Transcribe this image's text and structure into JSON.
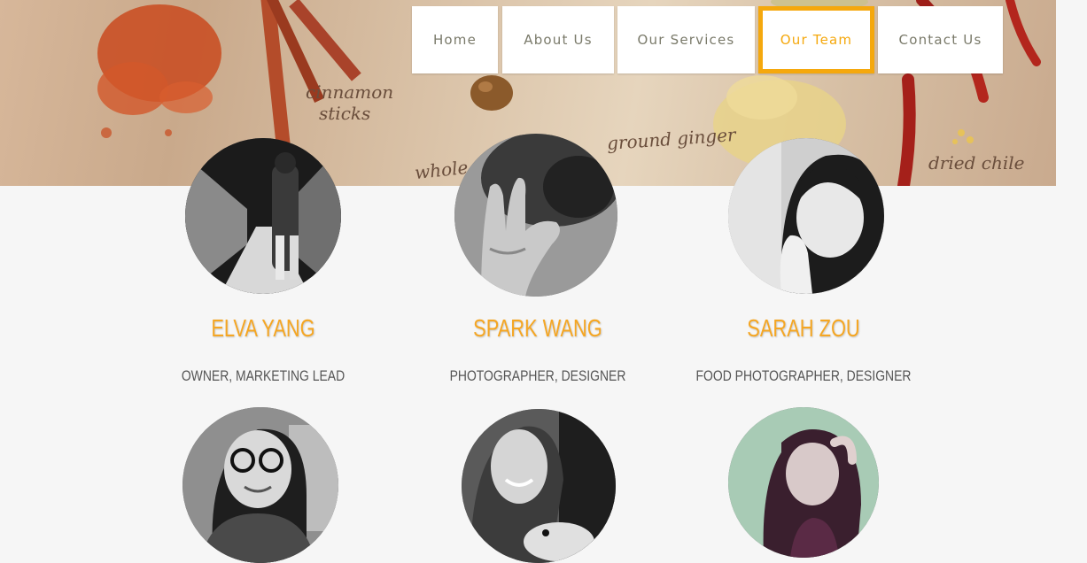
{
  "nav": {
    "items": [
      {
        "label": "Home"
      },
      {
        "label": "About Us"
      },
      {
        "label": "Our Services"
      },
      {
        "label": "Our Team",
        "active": true
      },
      {
        "label": "Contact Us"
      }
    ],
    "active_color": "#f5a80d"
  },
  "hero": {
    "labels": {
      "cinnamon": "cinnamon",
      "sticks": "sticks",
      "ginger": "ground ginger",
      "whole": "whole",
      "chile": "dried chile"
    }
  },
  "team": {
    "members": [
      {
        "name": "ELVA YANG",
        "role": "OWNER, MARKETING LEAD"
      },
      {
        "name": "SPARK WANG",
        "role": "PHOTOGRAPHER, DESIGNER"
      },
      {
        "name": "SARAH ZOU",
        "role": "FOOD PHOTOGRAPHER, DESIGNER"
      }
    ],
    "name_color": "#f5a623"
  }
}
